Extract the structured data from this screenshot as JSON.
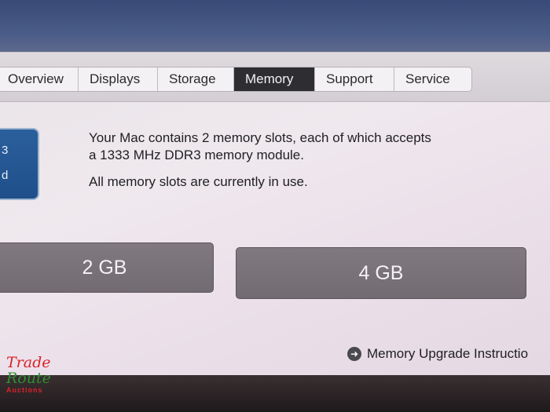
{
  "tabs": [
    {
      "label": "Overview",
      "active": false
    },
    {
      "label": "Displays",
      "active": false
    },
    {
      "label": "Storage",
      "active": false
    },
    {
      "label": "Memory",
      "active": true
    },
    {
      "label": "Support",
      "active": false
    },
    {
      "label": "Service",
      "active": false
    }
  ],
  "device_icon": {
    "line1": "3",
    "line2": "d"
  },
  "memory": {
    "description": "Your Mac contains 2 memory slots, each of which accepts a 1333 MHz DDR3 memory module.",
    "description_line1": "Your Mac contains 2 memory slots, each of which accepts",
    "description_line2": "a 1333 MHz DDR3 memory module.",
    "status": "All memory slots are currently in use.",
    "slots": [
      {
        "size": "2 GB"
      },
      {
        "size": "4 GB"
      }
    ],
    "upgrade_link": "Memory Upgrade Instructio"
  },
  "watermark": {
    "line1": "Trade",
    "line2": "Route",
    "line3": "Auctions"
  },
  "colors": {
    "active_tab_bg": "#2e2d31",
    "slot_bg": "#7a747a",
    "device_icon_bg": "#2b5f9c"
  }
}
